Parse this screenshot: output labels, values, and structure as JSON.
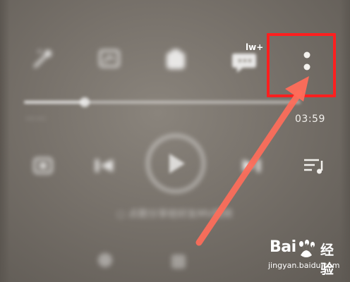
{
  "player": {
    "progress": {
      "played_fraction": 0.22,
      "time_total": "03:59",
      "time_played": "——"
    },
    "caption": "○ 点歌分享给好友MV视频"
  },
  "toolbar": {
    "icons": [
      "wand-icon",
      "chart-icon",
      "cube-icon",
      "comment-icon",
      "more-vertical-icon"
    ],
    "comment_badge": "lw+"
  },
  "controls": {
    "icons": [
      "loop-icon",
      "previous-icon",
      "play-icon",
      "next-icon",
      "playlist-icon"
    ]
  },
  "annotation": {
    "highlight_color": "#ff1f1f",
    "arrow_color": "#ff6d5a"
  },
  "watermark": {
    "brand_baidu": "Bai",
    "brand_du": "du",
    "brand_jingyan": "经验",
    "url": "jingyan.baidu.com"
  }
}
